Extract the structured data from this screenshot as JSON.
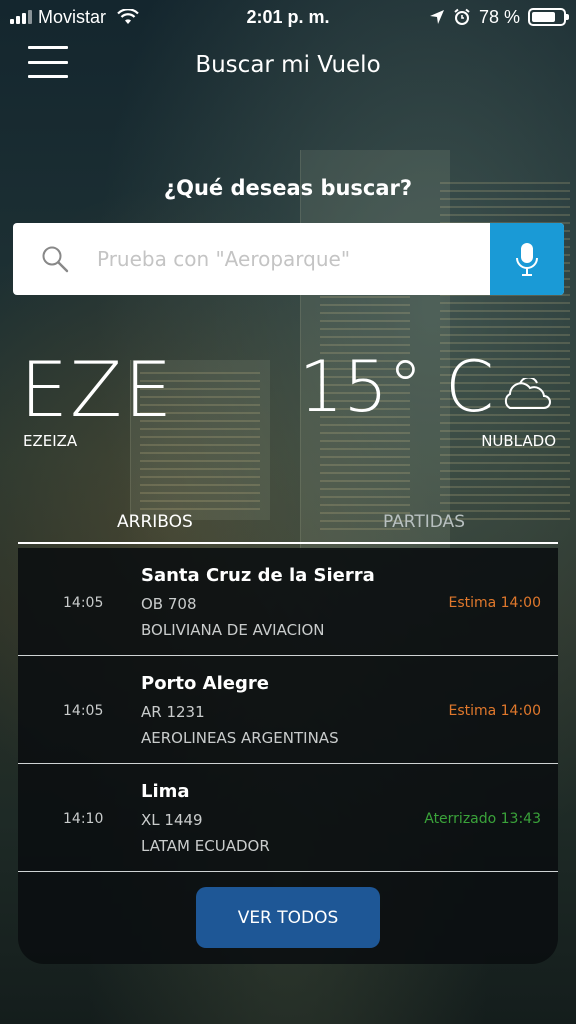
{
  "status_bar": {
    "carrier": "Movistar",
    "time": "2:01 p. m.",
    "battery": "78 %",
    "battery_level": 0.78
  },
  "header": {
    "title": "Buscar mi Vuelo"
  },
  "search": {
    "question": "¿Qué deseas buscar?",
    "placeholder": "Prueba con \"Aeroparque\""
  },
  "airport": {
    "code": "EZE",
    "name": "EZEIZA"
  },
  "weather": {
    "temperature": "15° C",
    "condition": "NUBLADO"
  },
  "tabs": {
    "arrivals": "ARRIBOS",
    "departures": "PARTIDAS"
  },
  "flights": [
    {
      "time": "14:05",
      "city": "Santa Cruz de la Sierra",
      "number": "OB 708",
      "airline": "BOLIVIANA DE AVIACION",
      "status": "Estima 14:00",
      "status_color": "#e0782c"
    },
    {
      "time": "14:05",
      "city": "Porto Alegre",
      "number": "AR 1231",
      "airline": "AEROLINEAS ARGENTINAS",
      "status": "Estima 14:00",
      "status_color": "#e0782c"
    },
    {
      "time": "14:10",
      "city": "Lima",
      "number": "XL 1449",
      "airline": "LATAM ECUADOR",
      "status": "Aterrizado 13:43",
      "status_color": "#3aa33a"
    }
  ],
  "view_all_label": "VER TODOS",
  "colors": {
    "mic_button": "#1a9ad6",
    "view_all_button": "#1e5796"
  },
  "icons": {
    "menu": "hamburger-menu-icon",
    "search": "search-icon",
    "mic": "microphone-icon",
    "weather": "cloud-icon"
  }
}
